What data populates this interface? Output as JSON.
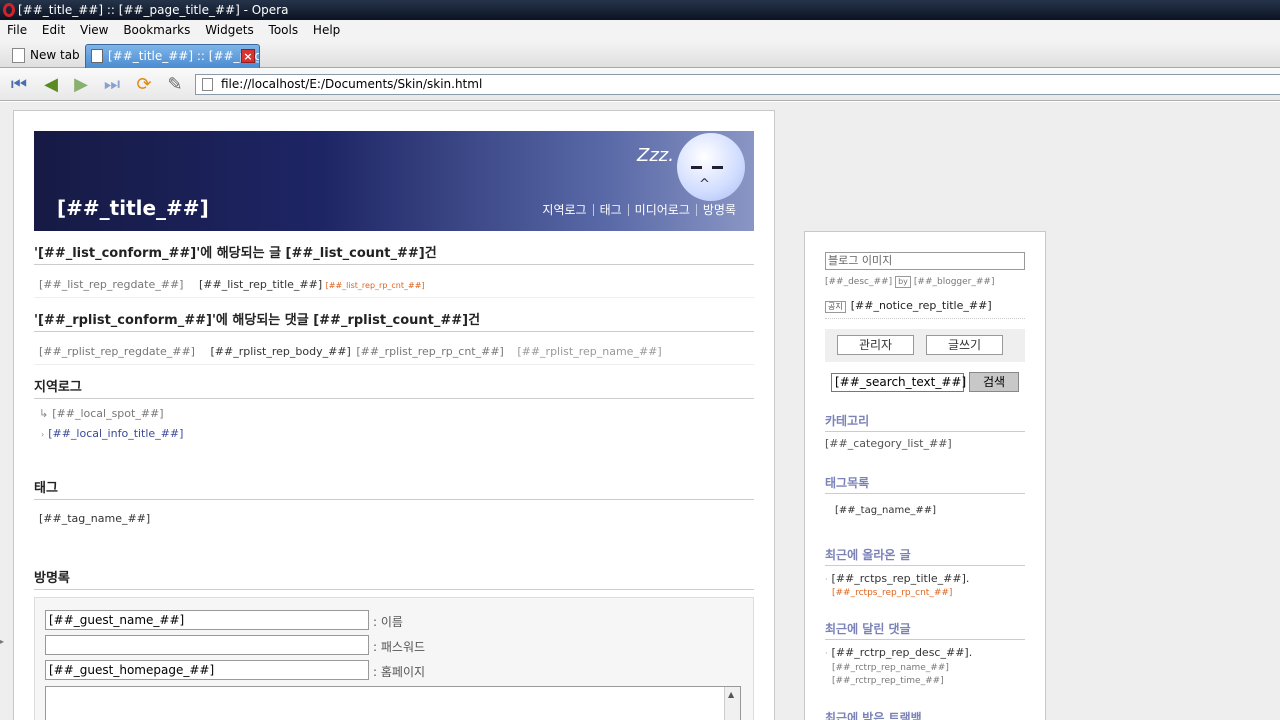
{
  "window": {
    "title": "[##_title_##] :: [##_page_title_##] - Opera"
  },
  "menu": [
    "File",
    "Edit",
    "View",
    "Bookmarks",
    "Widgets",
    "Tools",
    "Help"
  ],
  "tabs": [
    {
      "label": "New tab"
    },
    {
      "label": "[##_title_##] :: [##_pag...",
      "active": true
    }
  ],
  "address": {
    "url": "file://localhost/E:/Documents/Skin/skin.html"
  },
  "header": {
    "title": "[##_title_##]",
    "zzz": "Zzz.",
    "nav": [
      "지역로그",
      "태그",
      "미디어로그",
      "방명록"
    ]
  },
  "list_section": {
    "title": "'[##_list_conform_##]'에 해당되는 글 [##_list_count_##]건",
    "regdate": "[##_list_rep_regdate_##]",
    "rep_title": "[##_list_rep_title_##]",
    "rp_cnt": "[##_list_rep_rp_cnt_##]"
  },
  "rplist_section": {
    "title": "'[##_rplist_conform_##]'에 해당되는 댓글 [##_rplist_count_##]건",
    "regdate": "[##_rplist_rep_regdate_##]",
    "body": "[##_rplist_rep_body_##]",
    "rp_cnt": "[##_rplist_rep_rp_cnt_##]",
    "name": "[##_rplist_rep_name_##]"
  },
  "local_section": {
    "title": "지역로그",
    "spot": "[##_local_spot_##]",
    "info_title": "[##_local_info_title_##]"
  },
  "tag_section": {
    "title": "태그",
    "tag_name": "[##_tag_name_##]"
  },
  "guestbook": {
    "title": "방명록",
    "name_value": "[##_guest_name_##]",
    "name_label": ": 이름",
    "password_label": ": 패스워드",
    "homepage_value": "[##_guest_homepage_##]",
    "homepage_label": ": 홈페이지"
  },
  "sidebar": {
    "blog_image": "블로그 이미지",
    "desc": "[##_desc_##]",
    "by": "by",
    "blogger": "[##_blogger_##]",
    "notice_badge": "공지",
    "notice_title": "[##_notice_rep_title_##]",
    "admin_button": "관리자",
    "write_button": "글쓰기",
    "search_value": "[##_search_text_##]",
    "search_button": "검색",
    "category_head": "카테고리",
    "category_list": "[##_category_list_##]",
    "tag_head": "태그목록",
    "tag_name": "[##_tag_name_##]",
    "recent_posts_head": "최근에 올라온 글",
    "rctps_title": "[##_rctps_rep_title_##].",
    "rctps_cnt": "[##_rctps_rep_rp_cnt_##]",
    "recent_replies_head": "최근에 달린 댓글",
    "rctrp_desc": "[##_rctrp_rep_desc_##].",
    "rctrp_name": "[##_rctrp_rep_name_##]",
    "rctrp_time": "[##_rctrp_rep_time_##]",
    "trackback_head": "최근에 받은 트랙백"
  }
}
